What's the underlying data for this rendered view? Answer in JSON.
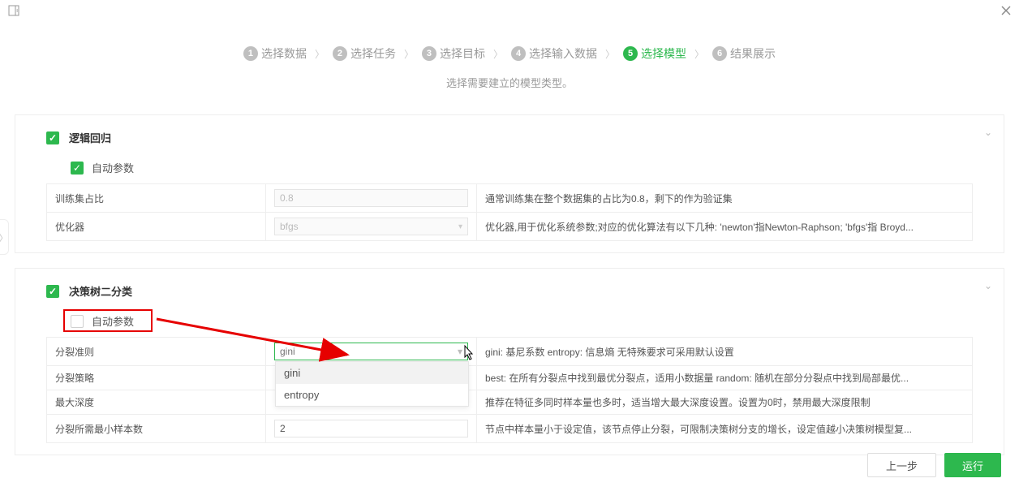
{
  "topbar": {
    "left_icon": "panel-toggle-icon",
    "close_icon": "close-icon"
  },
  "steps": [
    {
      "n": "1",
      "label": "选择数据",
      "active": false
    },
    {
      "n": "2",
      "label": "选择任务",
      "active": false
    },
    {
      "n": "3",
      "label": "选择目标",
      "active": false
    },
    {
      "n": "4",
      "label": "选择输入数据",
      "active": false
    },
    {
      "n": "5",
      "label": "选择模型",
      "active": true
    },
    {
      "n": "6",
      "label": "结果展示",
      "active": false
    }
  ],
  "subtitle": "选择需要建立的模型类型。",
  "panel1": {
    "title": "逻辑回归",
    "auto_label": "自动参数",
    "rows": [
      {
        "name": "训练集占比",
        "val": "0.8",
        "desc": "通常训练集在整个数据集的占比为0.8，剩下的作为验证集",
        "type": "disabled_text"
      },
      {
        "name": "优化器",
        "val": "bfgs",
        "desc": "优化器,用于优化系统参数;对应的优化算法有以下几种: 'newton'指Newton-Raphson; 'bfgs'指 Broyd...",
        "type": "disabled_select"
      }
    ]
  },
  "panel2": {
    "title": "决策树二分类",
    "auto_label": "自动参数",
    "rows": [
      {
        "name": "分裂准则",
        "val": "gini",
        "placeholder": "gini",
        "desc": "gini: 基尼系数 entropy: 信息熵 无特殊要求可采用默认设置",
        "type": "active_select"
      },
      {
        "name": "分裂策略",
        "val": "",
        "desc": "best: 在所有分裂点中找到最优分裂点，适用小数据量 random: 随机在部分分裂点中找到局部最优...",
        "type": "none"
      },
      {
        "name": "最大深度",
        "val": "",
        "desc": "推荐在特征多同时样本量也多时，适当增大最大深度设置。设置为0时，禁用最大深度限制",
        "type": "none"
      },
      {
        "name": "分裂所需最小样本数",
        "val": "2",
        "desc": "节点中样本量小于设定值，该节点停止分裂，可限制决策树分支的增长，设定值越小决策树模型复...",
        "type": "plain"
      }
    ]
  },
  "dropdown": {
    "options": [
      "gini",
      "entropy"
    ]
  },
  "footer": {
    "prev": "上一步",
    "run": "运行"
  }
}
